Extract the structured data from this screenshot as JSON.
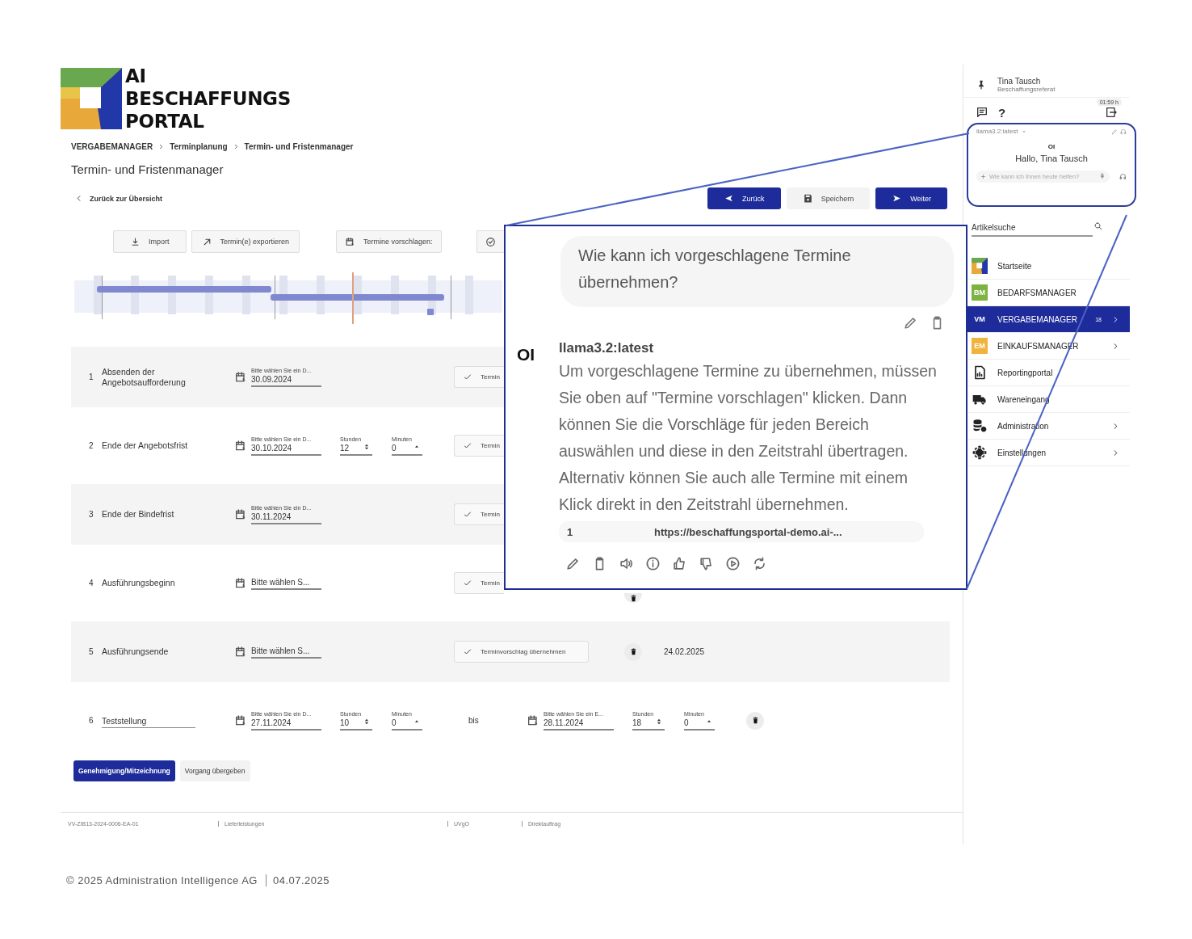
{
  "logo": {
    "lines": [
      "AI",
      "BESCHAFFUNGS",
      "PORTAL"
    ]
  },
  "breadcrumb": [
    "VERGABEMANAGER",
    "Terminplanung",
    "Termin- und Fristenmanager"
  ],
  "page_title": "Termin- und Fristenmanager",
  "back_link": "Zurück zur Übersicht",
  "actions": [
    {
      "label": "Zurück",
      "kind": "back",
      "primary": true
    },
    {
      "label": "Speichern",
      "kind": "save",
      "primary": false
    },
    {
      "label": "Weiter",
      "kind": "send",
      "primary": true
    }
  ],
  "toolbar": [
    {
      "label": "Import",
      "kind": "download"
    },
    {
      "label": "Termin(e) exportieren",
      "kind": "export"
    },
    {
      "label": "Termine vorschlagen:",
      "kind": "calendar"
    },
    {
      "kind": "check-circle"
    }
  ],
  "rows": [
    {
      "number": "1",
      "title": "Absenden der Angebotsaufforderung",
      "editable": false,
      "date": {
        "label": "Bitte wählen Sie ein D...",
        "value": "30.09.2024"
      },
      "accept": "Termin",
      "accept_cut": true,
      "delete": false
    },
    {
      "number": "2",
      "title": "Ende der Angebotsfrist",
      "editable": false,
      "date": {
        "label": "Bitte wählen Sie ein D...",
        "value": "30.10.2024"
      },
      "hours": {
        "label": "Stunden",
        "value": "12"
      },
      "minutes": {
        "label": "Minuten",
        "value": "0"
      },
      "accept": "Termin",
      "accept_cut": true,
      "delete": false
    },
    {
      "number": "3",
      "title": "Ende der Bindefrist",
      "editable": false,
      "date": {
        "label": "Bitte wählen Sie ein D...",
        "value": "30.11.2024"
      },
      "accept": "Termin",
      "accept_cut": true,
      "delete": false
    },
    {
      "number": "4",
      "title": "Ausführungsbeginn",
      "editable": false,
      "date": {
        "placeholder": "Bitte wählen S..."
      },
      "accept": "Termin",
      "accept_cut": true,
      "delete": true,
      "delete_cut": true
    },
    {
      "number": "5",
      "title": "Ausführungsende",
      "editable": false,
      "date": {
        "placeholder": "Bitte wählen S..."
      },
      "accept": "Terminvorschlag übernehmen",
      "accept_cut": false,
      "delete": true,
      "delete_cut": false,
      "proposal": "24.02.2025"
    },
    {
      "number": "6",
      "title": "Teststellung",
      "editable": true,
      "date": {
        "label": "Bitte wählen Sie ein D...",
        "value": "27.11.2024"
      },
      "hours": {
        "label": "Stunden",
        "value": "10"
      },
      "minutes": {
        "label": "Minuten",
        "value": "0"
      },
      "range_word": "bis",
      "end": {
        "date": {
          "label": "Bitte wählen Sie ein E...",
          "value": "28.11.2024"
        },
        "hours": {
          "label": "Stunden",
          "value": "18"
        },
        "minutes": {
          "label": "Minuten",
          "value": "0"
        }
      },
      "delete": true,
      "delete_cut": false
    }
  ],
  "bottom_buttons": [
    {
      "label": "Genehmigung/Mitzeichnung",
      "primary": true
    },
    {
      "label": "Vorgang übergeben",
      "primary": false
    }
  ],
  "meta": [
    "VV-ZIB13-2024-0006-EA-01",
    "Lieferleistungen",
    "UVgO",
    "Direktauftrag"
  ],
  "copyright": {
    "owner": "© 2025 Administration Intelligence AG",
    "date": "04.07.2025"
  },
  "sidebar": {
    "user": {
      "name": "Tina Tausch",
      "role": "Beschaffungsreferat"
    },
    "timer": "01:59 h",
    "help": "?",
    "mini_chat": {
      "model": "llama3.2:latest",
      "logo": "OI",
      "greeting": "Hallo, Tina Tausch",
      "placeholder": "Wie kann ich Ihnen heute helfen?"
    },
    "search": {
      "placeholder": "Artikelsuche"
    },
    "nav": [
      {
        "label": "Startseite",
        "kind": "logo",
        "selected": false,
        "submenu": false
      },
      {
        "label": "BEDARFSMANAGER",
        "kind": "tile",
        "tile_text": "BM",
        "color": "#7cb342",
        "selected": false,
        "submenu": false
      },
      {
        "label": "VERGABEMANAGER",
        "kind": "tile",
        "tile_text": "VM",
        "color": "#1e2b9a",
        "selected": true,
        "badge": "18",
        "submenu": true
      },
      {
        "label": "EINKAUFSMANAGER",
        "kind": "tile",
        "tile_text": "EM",
        "color": "#f0b43c",
        "selected": false,
        "submenu": true
      },
      {
        "label": "Reportingportal",
        "kind": "report",
        "selected": false,
        "submenu": false
      },
      {
        "label": "Wareneingang",
        "kind": "truck",
        "selected": false,
        "submenu": false
      },
      {
        "label": "Administration",
        "kind": "database",
        "selected": false,
        "submenu": true
      },
      {
        "label": "Einstellungen",
        "kind": "gear",
        "selected": false,
        "submenu": true
      }
    ]
  },
  "chat": {
    "question": "Wie kann ich vorgeschlagene Termine übernehmen?",
    "question_actions": [
      {
        "kind": "edit"
      },
      {
        "kind": "copy"
      }
    ],
    "logo": "OI",
    "model": "llama3.2:latest",
    "answer": "Um vorgeschlagene Termine zu übernehmen, müssen Sie oben auf \"Termine vorschlagen\" klicken. Dann können Sie die Vorschläge für jeden Bereich auswählen und diese in den Zeitstrahl übertragen. Alternativ können Sie auch alle Termine mit einem Klick direkt in den Zeitstrahl übernehmen.",
    "source": {
      "number": "1",
      "url": "https://beschaffungsportal-demo.ai-..."
    },
    "answer_actions": [
      {
        "kind": "edit"
      },
      {
        "kind": "copy"
      },
      {
        "kind": "speaker"
      },
      {
        "kind": "info"
      },
      {
        "kind": "thumbs-up"
      },
      {
        "kind": "thumbs-down"
      },
      {
        "kind": "play"
      },
      {
        "kind": "regenerate"
      }
    ]
  }
}
